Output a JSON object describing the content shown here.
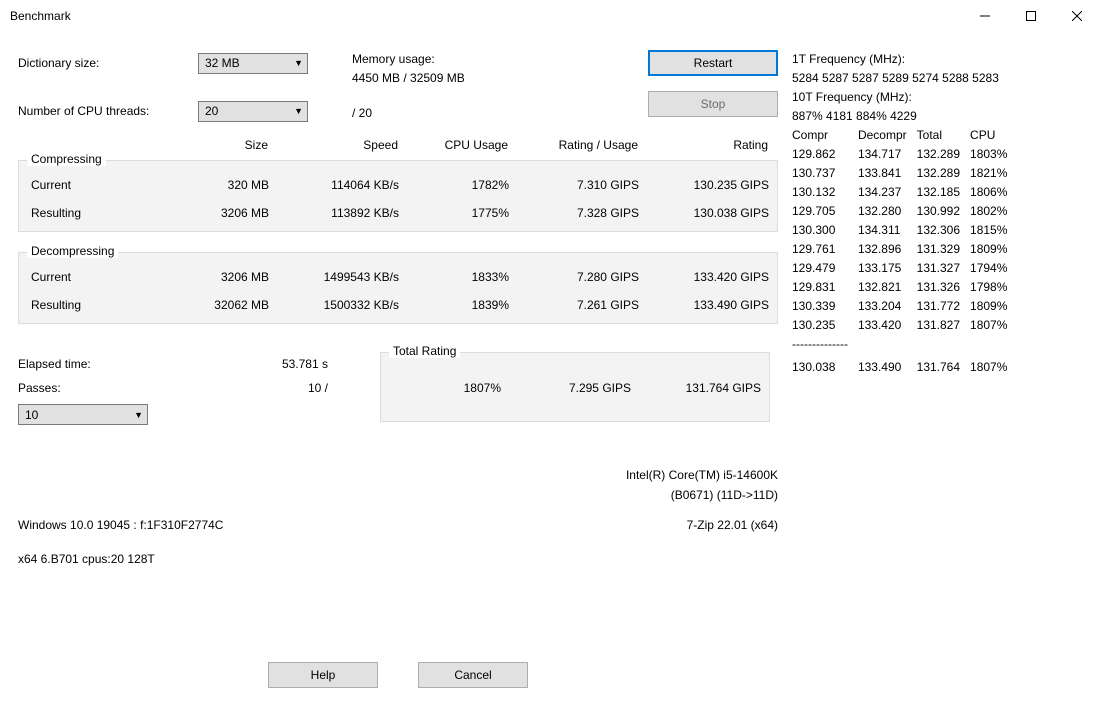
{
  "window": {
    "title": "Benchmark"
  },
  "labels": {
    "dict_size": "Dictionary size:",
    "threads": "Number of CPU threads:",
    "mem_usage": "Memory usage:",
    "restart": "Restart",
    "stop": "Stop",
    "size": "Size",
    "speed": "Speed",
    "cpu_usage": "CPU Usage",
    "rating_usage": "Rating / Usage",
    "rating": "Rating",
    "compressing": "Compressing",
    "decompressing": "Decompressing",
    "current": "Current",
    "resulting": "Resulting",
    "elapsed": "Elapsed time:",
    "passes": "Passes:",
    "total_rating": "Total Rating",
    "help": "Help",
    "cancel": "Cancel"
  },
  "dict_value": "32 MB",
  "threads_value": "20",
  "threads_suffix": "/ 20",
  "mem_value": "4450 MB / 32509 MB",
  "elapsed_value": "53.781 s",
  "passes_value": "10 /",
  "passes_select": "10",
  "compress": {
    "current": {
      "size": "320 MB",
      "speed": "114064 KB/s",
      "cpu": "1782%",
      "ru": "7.310 GIPS",
      "rating": "130.235 GIPS"
    },
    "resulting": {
      "size": "3206 MB",
      "speed": "113892 KB/s",
      "cpu": "1775%",
      "ru": "7.328 GIPS",
      "rating": "130.038 GIPS"
    }
  },
  "decompress": {
    "current": {
      "size": "3206 MB",
      "speed": "1499543 KB/s",
      "cpu": "1833%",
      "ru": "7.280 GIPS",
      "rating": "133.420 GIPS"
    },
    "resulting": {
      "size": "32062 MB",
      "speed": "1500332 KB/s",
      "cpu": "1839%",
      "ru": "7.261 GIPS",
      "rating": "133.490 GIPS"
    }
  },
  "total": {
    "cpu": "1807%",
    "ru": "7.295 GIPS",
    "rating": "131.764 GIPS"
  },
  "cpu_name": "Intel(R) Core(TM) i5-14600K",
  "cpu_sub": "(B0671) (11D->11D)",
  "os_line": "Windows 10.0 19045 :  f:1F310F2774C",
  "app_line": "7-Zip 22.01 (x64)",
  "arch_line": "x64 6.B701 cpus:20 128T",
  "right": {
    "freq1_label": "1T Frequency (MHz):",
    "freq1_value": " 5284 5287 5287 5289 5274 5288 5283",
    "freq10_label": "10T Frequency (MHz):",
    "freq10_value": " 887% 4181 884% 4229",
    "hdr": {
      "c": "Compr",
      "d": "Decompr",
      "t": "Total",
      "cpu": "CPU"
    },
    "rows": [
      {
        "c": "129.862",
        "d": "134.717",
        "t": "132.289",
        "cpu": "1803%"
      },
      {
        "c": "130.737",
        "d": "133.841",
        "t": "132.289",
        "cpu": "1821%"
      },
      {
        "c": "130.132",
        "d": "134.237",
        "t": "132.185",
        "cpu": "1806%"
      },
      {
        "c": "129.705",
        "d": "132.280",
        "t": "130.992",
        "cpu": "1802%"
      },
      {
        "c": "130.300",
        "d": "134.311",
        "t": "132.306",
        "cpu": "1815%"
      },
      {
        "c": "129.761",
        "d": "132.896",
        "t": "131.329",
        "cpu": "1809%"
      },
      {
        "c": "129.479",
        "d": "133.175",
        "t": "131.327",
        "cpu": "1794%"
      },
      {
        "c": "129.831",
        "d": "132.821",
        "t": "131.326",
        "cpu": "1798%"
      },
      {
        "c": "130.339",
        "d": "133.204",
        "t": "131.772",
        "cpu": "1809%"
      },
      {
        "c": "130.235",
        "d": "133.420",
        "t": "131.827",
        "cpu": "1807%"
      }
    ],
    "sep": "--------------",
    "summary": {
      "c": "130.038",
      "d": "133.490",
      "t": "131.764",
      "cpu": "1807%"
    }
  }
}
